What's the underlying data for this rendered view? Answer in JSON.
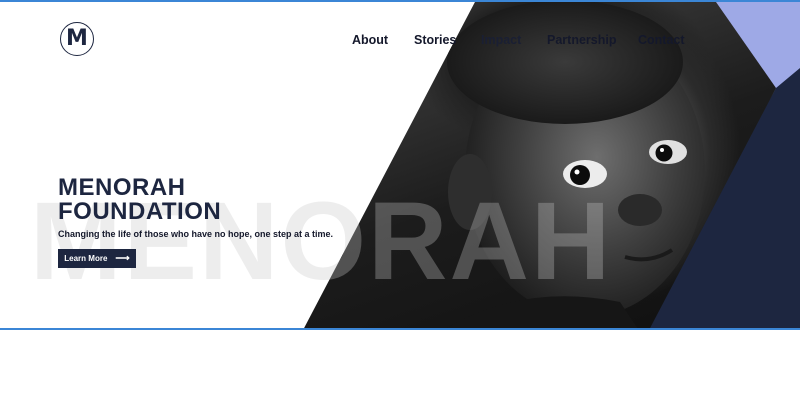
{
  "brand": {
    "logo_letter": "M",
    "logo_icon": "menorah-m-logo-icon"
  },
  "nav": {
    "items": [
      {
        "label": "About"
      },
      {
        "label": "Stories"
      },
      {
        "label": "Impact"
      },
      {
        "label": "Partnership"
      },
      {
        "label": "Contact"
      }
    ]
  },
  "hero": {
    "title_line1": "MENORAH",
    "title_line2": "FOUNDATION",
    "tagline": "Changing the life of those who have no hope,  one step at a time.",
    "cta_label": "Learn More",
    "cta_icon": "arrow-right-icon",
    "watermark": "MENORAH",
    "image_subject": "black-and-white portrait of a child"
  },
  "colors": {
    "navy": "#1d2640",
    "accent_light": "#9ea9e6",
    "border_blue": "#3b86d6",
    "text_dark": "#14182b",
    "background": "#ffffff"
  }
}
